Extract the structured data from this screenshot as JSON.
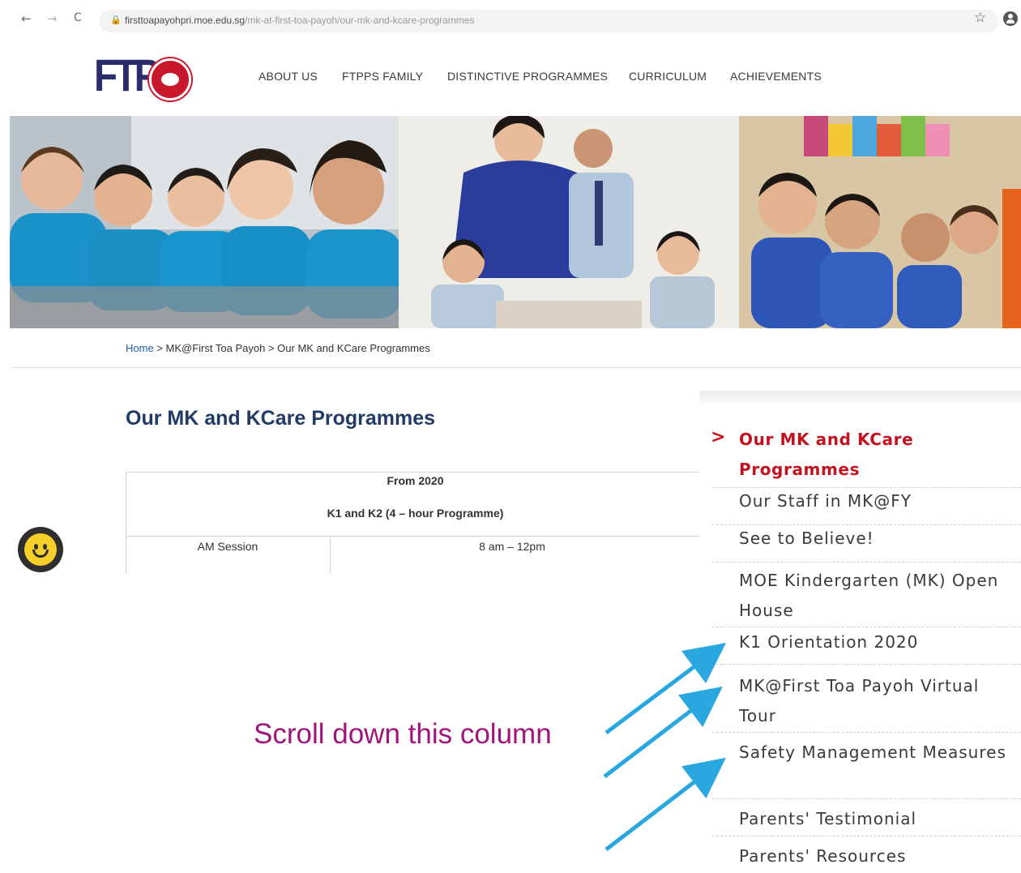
{
  "browser": {
    "url_host": "firsttoapayohpri.moe.edu.sg",
    "url_path": "/mk-at-first-toa-payoh/our-mk-and-kcare-programmes",
    "back_glyph": "←",
    "forward_glyph": "→",
    "reload_glyph": "C",
    "star_glyph": "☆"
  },
  "logo": {
    "text": "FTPP"
  },
  "menu": [
    {
      "label": "ABOUT US"
    },
    {
      "label": "FTPPS FAMILY"
    },
    {
      "label": "DISTINCTIVE PROGRAMMES"
    },
    {
      "label": "CURRICULUM"
    },
    {
      "label": "ACHIEVEMENTS"
    }
  ],
  "breadcrumb": {
    "home": "Home",
    "sep": ">",
    "parent": "MK@First Toa Payoh",
    "current": "Our MK and KCare Programmes"
  },
  "page": {
    "title": "Our MK and KCare Programmes"
  },
  "table": {
    "header1": "From 2020",
    "header2": "K1 and K2 (4 – hour Programme)",
    "rows": [
      {
        "session": "AM Session",
        "time": "8 am – 12pm"
      }
    ]
  },
  "sidebar": {
    "chevron": ">",
    "items": [
      {
        "label": "Our MK and KCare Programmes",
        "active": true
      },
      {
        "label": "Our Staff in MK@FY"
      },
      {
        "label": "See to Believe!"
      },
      {
        "label": "MOE Kindergarten (MK) Open House"
      },
      {
        "label": "K1 Orientation 2020"
      },
      {
        "label": "MK@First Toa Payoh Virtual Tour"
      },
      {
        "label": "Safety Management Measures"
      },
      {
        "label": "Parents' Testimonial"
      },
      {
        "label": "Parents' Resources"
      }
    ]
  },
  "annotation": {
    "text": "Scroll down this column"
  },
  "colors": {
    "accent_red": "#c1121f",
    "title_navy": "#223a66",
    "link_blue": "#1a5fa8",
    "annotation_magenta": "#a0157c",
    "arrow_blue": "#2aa7df"
  }
}
